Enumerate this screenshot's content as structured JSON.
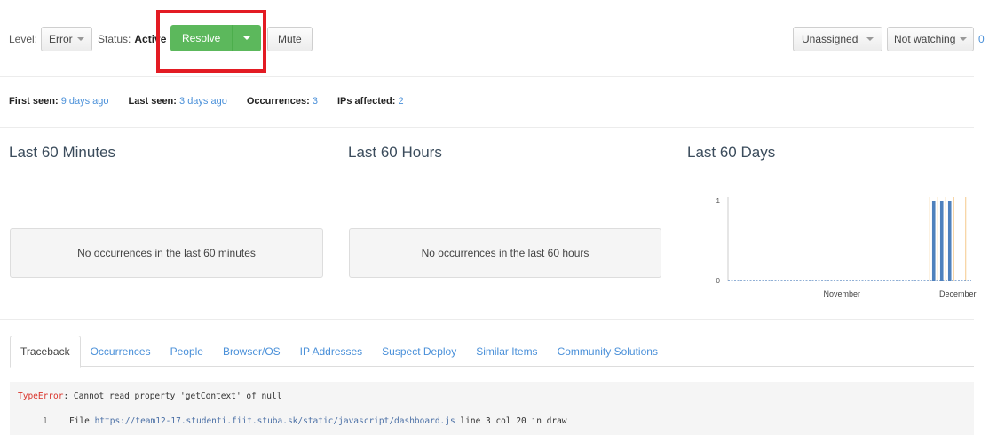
{
  "toolbar": {
    "level_label": "Level:",
    "level_value": "Error",
    "status_label": "Status:",
    "status_value": "Active",
    "resolve_label": "Resolve",
    "mute_label": "Mute",
    "assignee_value": "Unassigned",
    "watch_value": "Not watching",
    "watch_count": "0"
  },
  "stats": {
    "first_seen_label": "First seen:",
    "first_seen_value": "9 days ago",
    "last_seen_label": "Last seen:",
    "last_seen_value": "3 days ago",
    "occurrences_label": "Occurrences:",
    "occurrences_value": "3",
    "ips_label": "IPs affected:",
    "ips_value": "2"
  },
  "sections": {
    "minutes_title": "Last 60 Minutes",
    "hours_title": "Last 60 Hours",
    "days_title": "Last 60 Days",
    "minutes_empty": "No occurrences in the last 60 minutes",
    "hours_empty": "No occurrences in the last 60 hours"
  },
  "chart_data": {
    "type": "bar",
    "title": "Last 60 Days",
    "y_ticks": [
      "1",
      "0"
    ],
    "ylim": [
      0,
      1
    ],
    "x_tick_labels": [
      "November",
      "December"
    ],
    "x_tick_label_day_index": [
      29,
      58
    ],
    "days": 60,
    "occurrence_day_index": [
      52,
      54,
      56
    ],
    "values": [
      1,
      1,
      1
    ],
    "deploy_markers_day_index": [
      51,
      53,
      55,
      57,
      60
    ],
    "colors": {
      "bar": "#4f81bd",
      "deploy": "#f5c98b",
      "baseline": "#4f81bd",
      "axis": "#cccccc"
    }
  },
  "tabs": [
    {
      "label": "Traceback",
      "active": true
    },
    {
      "label": "Occurrences",
      "active": false
    },
    {
      "label": "People",
      "active": false
    },
    {
      "label": "Browser/OS",
      "active": false
    },
    {
      "label": "IP Addresses",
      "active": false
    },
    {
      "label": "Suspect Deploy",
      "active": false
    },
    {
      "label": "Similar Items",
      "active": false
    },
    {
      "label": "Community Solutions",
      "active": false
    }
  ],
  "traceback": {
    "error_type": "TypeError",
    "error_message": ": Cannot read property 'getContext' of null",
    "frame_number": "1",
    "file_prefix": "File ",
    "file_url": "https://team12-17.studenti.fiit.stuba.sk/static/javascript/dashboard.js",
    "file_suffix": " line 3 col 20 in draw"
  }
}
